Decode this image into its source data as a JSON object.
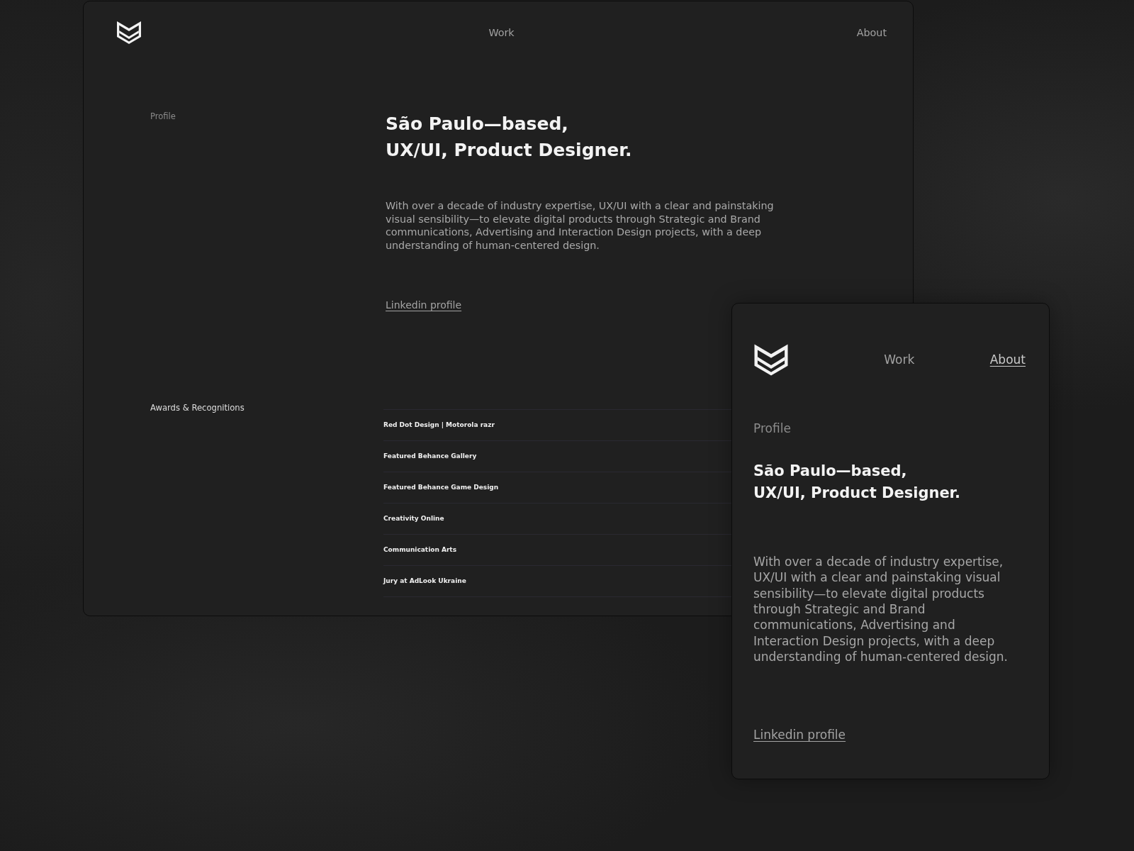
{
  "desktop_page": {
    "nav": [
      {
        "label": "Work",
        "selected": false
      },
      {
        "label": "About",
        "selected": false
      }
    ],
    "profile": {
      "label": "Profile",
      "heading": "São Paulo—based,\nUX/UI, Product Designer.",
      "bio": "With over a decade of industry expertise, UX/UI with a clear and painstaking visual sensibility—to elevate digital products through Strategic and Brand communications, Advertising and Interaction Design projects, with a deep understanding of human-centered design.",
      "link": "Linkedin profile"
    },
    "awards": {
      "label": "Awards & Recognitions",
      "items": [
        "Red Dot Design | Motorola razr",
        "Featured Behance Gallery",
        "Featured Behance Game Design",
        "Creativity Online",
        "Communication Arts",
        "Jury at AdLook Ukraine"
      ]
    }
  },
  "mobile_page": {
    "nav": [
      {
        "label": "Work",
        "selected": false
      },
      {
        "label": "About",
        "selected": true
      }
    ],
    "profile": {
      "label": "Profile",
      "heading": "São Paulo—based,\nUX/UI, Product Designer.",
      "bio": "With over a decade of industry expertise, UX/UI with a clear and painstaking visual sensibility—to elevate digital products through Strategic and Brand communications, Advertising and Interaction Design projects, with a deep understanding of human-centered design.",
      "link": "Linkedin profile"
    }
  }
}
